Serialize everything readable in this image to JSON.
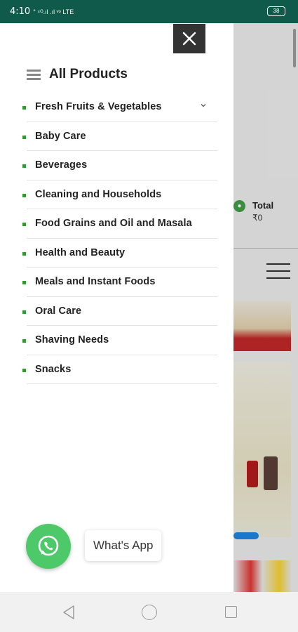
{
  "status_bar": {
    "time": "4:10",
    "network": "° ⁴ᴳ.ıl .ıl ᵛᵒ LTE",
    "battery": "38"
  },
  "background_page": {
    "total_label": "Total",
    "total_value": "₹0"
  },
  "drawer": {
    "title": "All Products",
    "categories": [
      "Fresh Fruits & Vegetables",
      "Baby Care",
      "Beverages",
      "Cleaning and Households",
      "Food Grains and Oil and Masala",
      "Health and Beauty",
      "Meals and Instant Foods",
      "Oral Care",
      "Shaving Needs",
      "Snacks"
    ]
  },
  "whatsapp": {
    "label": "What's App"
  },
  "colors": {
    "status_bar": "#0f5a4a",
    "bullet": "#2e9d2e",
    "whatsapp": "#4dc96a",
    "close_button": "#333333"
  },
  "icons": [
    "hamburger-icon",
    "close-icon",
    "chevron-down-icon",
    "whatsapp-icon",
    "back-icon",
    "home-icon",
    "recent-apps-icon"
  ]
}
